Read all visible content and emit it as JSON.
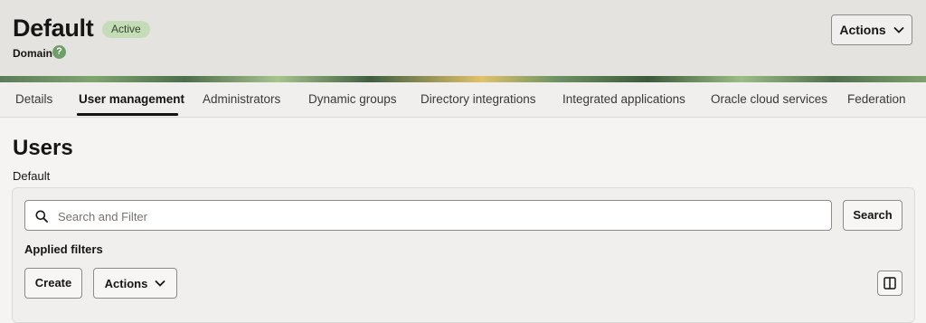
{
  "header": {
    "title": "Default",
    "status": "Active",
    "subtitle": "Domain",
    "help_icon": "question-circle-icon",
    "actions_label": "Actions"
  },
  "tabs": [
    {
      "label": "Details",
      "active": false
    },
    {
      "label": "User management",
      "active": true
    },
    {
      "label": "Administrators",
      "active": false
    },
    {
      "label": "Dynamic groups",
      "active": false
    },
    {
      "label": "Directory integrations",
      "active": false
    },
    {
      "label": "Integrated applications",
      "active": false
    },
    {
      "label": "Oracle cloud services",
      "active": false
    },
    {
      "label": "Federation",
      "active": false
    }
  ],
  "page": {
    "title": "Users",
    "subtitle": "Default"
  },
  "search": {
    "placeholder": "Search and Filter",
    "value": "",
    "button_label": "Search"
  },
  "filters": {
    "label": "Applied filters"
  },
  "toolbar": {
    "create_label": "Create",
    "actions_label": "Actions",
    "column_icon": "columns-icon"
  },
  "colors": {
    "status_badge_bg": "#c6dcb9",
    "header_bg": "#e5e3df",
    "page_bg": "#f5f4f2"
  }
}
